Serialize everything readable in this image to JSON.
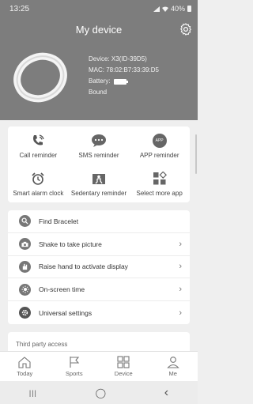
{
  "status": {
    "time": "13:25",
    "battery_pct": "40%"
  },
  "header": {
    "title": "My device"
  },
  "device": {
    "device_line": "Device: X3(ID-39D5)",
    "mac_line": "MAC: 78:02:B7:33:39:D5",
    "battery_label": "Battery:",
    "state": "Bound"
  },
  "features": [
    {
      "label": "Call reminder",
      "icon": "phone-ringing-icon"
    },
    {
      "label": "SMS reminder",
      "icon": "sms-bubble-icon"
    },
    {
      "label": "APP reminder",
      "icon": "app-badge-icon",
      "badge": "APP"
    },
    {
      "label": "Smart alarm clock",
      "icon": "alarm-clock-icon"
    },
    {
      "label": "Sedentary reminder",
      "icon": "sedentary-icon"
    },
    {
      "label": "Select more app",
      "icon": "grid-plus-icon"
    }
  ],
  "settings": [
    {
      "label": "Find Bracelet",
      "icon": "search-icon",
      "chevron": false
    },
    {
      "label": "Shake to take picture",
      "icon": "camera-icon",
      "chevron": true
    },
    {
      "label": "Raise hand to activate display",
      "icon": "raise-hand-icon",
      "chevron": true
    },
    {
      "label": "On-screen time",
      "icon": "sun-icon",
      "chevron": true
    },
    {
      "label": "Universal settings",
      "icon": "settings-icon",
      "chevron": true
    }
  ],
  "third_party": {
    "label": "Third party access"
  },
  "tabs": [
    {
      "label": "Today",
      "icon": "home-icon"
    },
    {
      "label": "Sports",
      "icon": "flag-icon"
    },
    {
      "label": "Device",
      "icon": "device-grid-icon"
    },
    {
      "label": "Me",
      "icon": "person-icon"
    }
  ],
  "nav": {
    "recents": "|||",
    "home": "◯",
    "back": "‹"
  }
}
